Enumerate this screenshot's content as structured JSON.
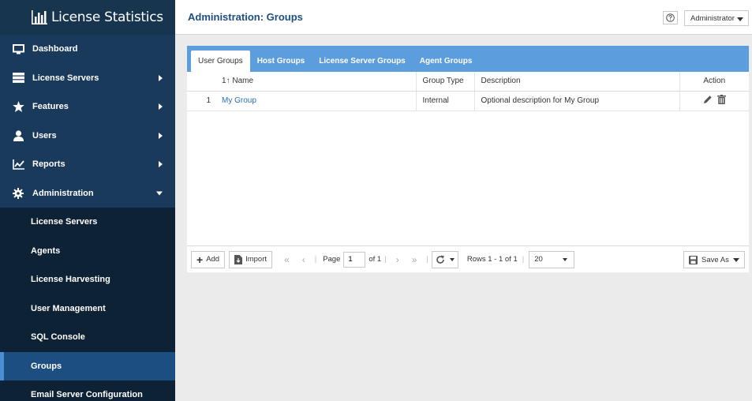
{
  "brand": {
    "name": "License Statistics"
  },
  "sidebar": {
    "items": [
      {
        "label": "Dashboard",
        "icon": "monitor-icon",
        "arrow": ""
      },
      {
        "label": "License Servers",
        "icon": "server-icon",
        "arrow": "right"
      },
      {
        "label": "Features",
        "icon": "star-icon",
        "arrow": "right"
      },
      {
        "label": "Users",
        "icon": "user-icon",
        "arrow": "right"
      },
      {
        "label": "Reports",
        "icon": "chart-icon",
        "arrow": "right"
      },
      {
        "label": "Administration",
        "icon": "gear-icon",
        "arrow": "down"
      }
    ],
    "sub_items": [
      {
        "label": "License Servers"
      },
      {
        "label": "Agents"
      },
      {
        "label": "License Harvesting"
      },
      {
        "label": "User Management"
      },
      {
        "label": "SQL Console"
      },
      {
        "label": "Groups",
        "active": true
      },
      {
        "label": "Email Server Configuration"
      }
    ]
  },
  "header": {
    "title": "Administration: Groups",
    "user_label": "Administrator"
  },
  "tabs": [
    "User Groups",
    "Host Groups",
    "License Server Groups",
    "Agent Groups"
  ],
  "table": {
    "headers": {
      "num": "1",
      "name": "Name",
      "group_type": "Group Type",
      "description": "Description",
      "action": "Action"
    },
    "rows": [
      {
        "num": "1",
        "name": "My Group",
        "group_type": "Internal",
        "description": "Optional description for My Group"
      }
    ]
  },
  "toolbar": {
    "add_label": "Add",
    "import_label": "Import",
    "page_label": "Page",
    "page_value": "1",
    "of_label": "of 1",
    "rows_label": "Rows 1 - 1 of 1",
    "page_size": "20",
    "saveas_label": "Save As"
  },
  "colors": {
    "sidebar_bg": "#1a3a5c",
    "tab_bar": "#5b9ddd",
    "accent": "#1d4e82",
    "link": "#2b6db5"
  }
}
